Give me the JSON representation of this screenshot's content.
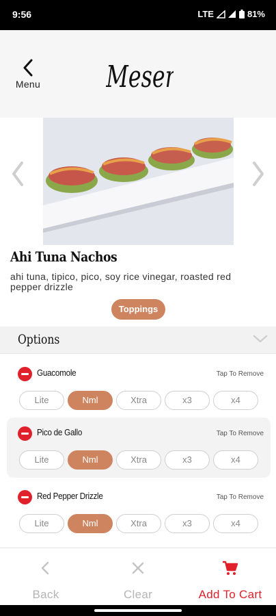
{
  "status_bar": {
    "time": "9:56",
    "network": "LTE",
    "battery": "81%"
  },
  "header": {
    "back_label": "Menu",
    "logo_text": "Mesero"
  },
  "dish": {
    "title": "Ahi Tuna Nachos",
    "description": "ahi tuna, tipico, pico, soy rice vinegar, roasted red pepper drizzle",
    "toppings_label": "Toppings"
  },
  "options": {
    "title": "Options",
    "tap_to_remove": "Tap To Remove",
    "groups": [
      {
        "name": "Guacomole",
        "choices": [
          "Lite",
          "Nml",
          "Xtra",
          "x3",
          "x4"
        ],
        "selected": "Nml"
      },
      {
        "name": "Pico de Gallo",
        "choices": [
          "Lite",
          "Nml",
          "Xtra",
          "x3",
          "x4"
        ],
        "selected": "Nml"
      },
      {
        "name": "Red Pepper Drizzle",
        "choices": [
          "Lite",
          "Nml",
          "Xtra",
          "x3",
          "x4"
        ],
        "selected": "Nml"
      }
    ]
  },
  "bottom_bar": {
    "back_label": "Back",
    "clear_label": "Clear",
    "add_to_cart_label": "Add To Cart"
  },
  "colors": {
    "accent": "#cf8460",
    "danger": "#e0202a",
    "muted": "#b4b4b4"
  }
}
